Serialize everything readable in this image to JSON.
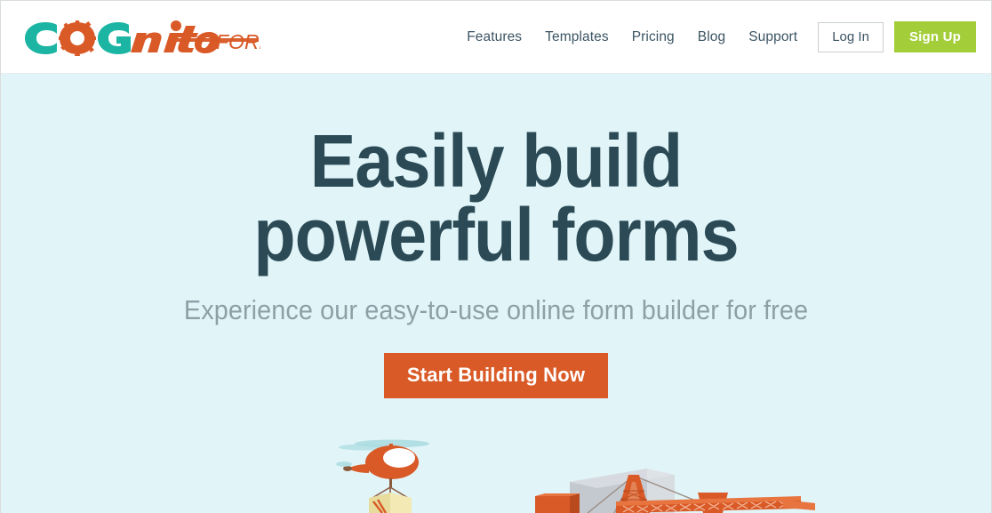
{
  "brand": {
    "logo_text_primary": "COGnito",
    "logo_text_secondary": "FORMS",
    "colors": {
      "teal": "#1CB5A3",
      "orange": "#D95A27",
      "green": "#A4CE39",
      "dark_slate": "#2B4A55",
      "hero_background": "#E1F5F9",
      "nav_text": "#3C5463",
      "sub_text": "#8F9FA6"
    }
  },
  "header": {
    "nav_items": [
      {
        "label": "Features"
      },
      {
        "label": "Templates"
      },
      {
        "label": "Pricing"
      },
      {
        "label": "Blog"
      },
      {
        "label": "Support"
      }
    ],
    "login_label": "Log In",
    "signup_label": "Sign Up"
  },
  "hero": {
    "title_line1": "Easily build",
    "title_line2": "powerful forms",
    "subtitle": "Experience our easy-to-use online form builder for free",
    "cta_label": "Start Building Now",
    "illustration": {
      "items": [
        "helicopter-icon",
        "cargo-crate-icon",
        "building-icon",
        "construction-crane-icon"
      ]
    }
  }
}
